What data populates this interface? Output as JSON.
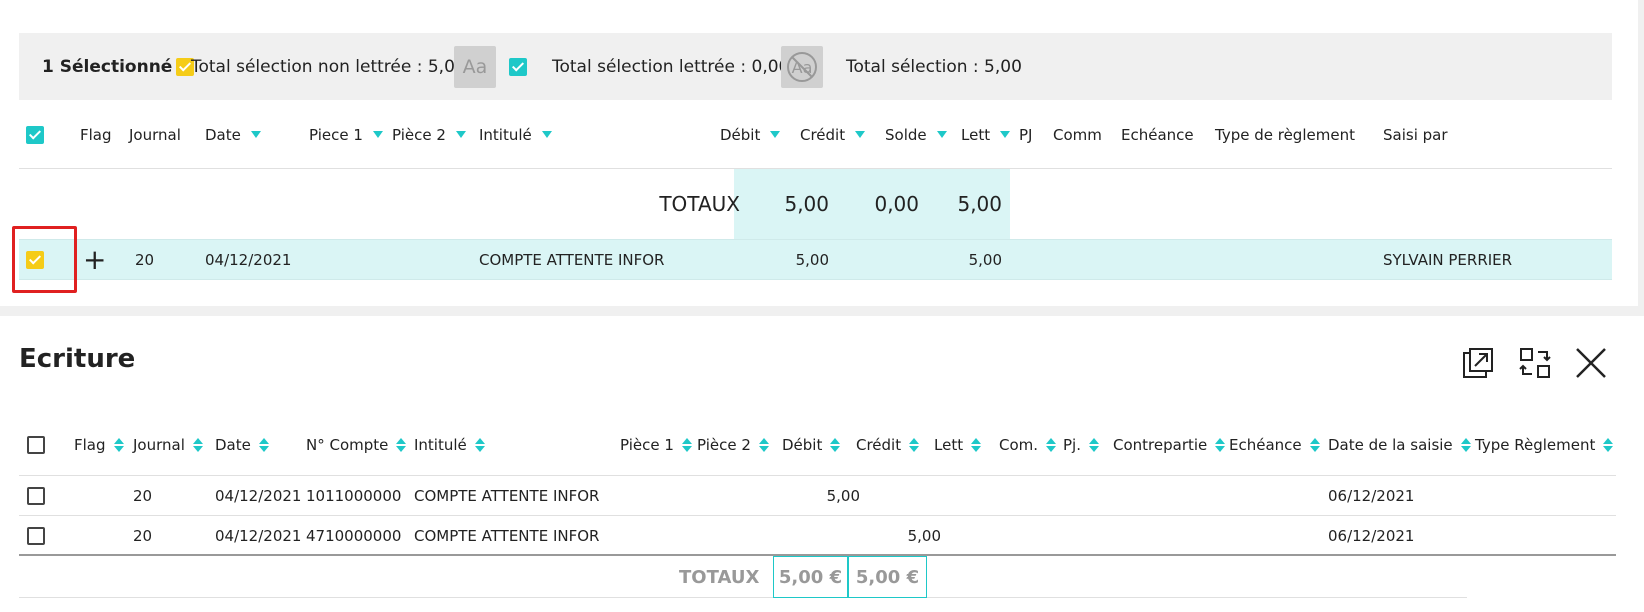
{
  "selection_bar": {
    "selected_label": "1 Sélectionné",
    "total_non_lettree": "Total sélection non lettrée : 5,00",
    "aa_label": "Aa",
    "total_lettree": "Total sélection lettrée : 0,00",
    "total_selection": "Total sélection : 5,00"
  },
  "top_table": {
    "columns": [
      "Flag",
      "Journal",
      "Date",
      "Piece 1",
      "Pièce 2",
      "Intitulé",
      "Débit",
      "Crédit",
      "Solde",
      "Lett",
      "PJ",
      "Comm",
      "Echéance",
      "Type de règlement",
      "Saisi par"
    ],
    "totals": {
      "label": "TOTAUX",
      "debit": "5,00",
      "credit": "0,00",
      "solde": "5,00"
    },
    "row": {
      "add": "+",
      "journal": "20",
      "date": "04/12/2021",
      "intitule": "COMPTE ATTENTE INFOR",
      "debit": "5,00",
      "solde": "5,00",
      "saisi_par": "SYLVAIN PERRIER"
    }
  },
  "ecriture": {
    "title": "Ecriture",
    "columns": [
      "Flag",
      "Journal",
      "Date",
      "N° Compte",
      "Intitulé",
      "Pièce 1",
      "Pièce 2",
      "Débit",
      "Crédit",
      "Lett",
      "Com.",
      "Pj.",
      "Contrepartie",
      "Echéance",
      "Date de la saisie",
      "Type Règlement"
    ],
    "rows": [
      {
        "journal": "20",
        "date": "04/12/2021",
        "compte": "1011000000",
        "intitule": "COMPTE ATTENTE INFOR",
        "debit": "5,00",
        "credit": "",
        "date_saisie": "06/12/2021"
      },
      {
        "journal": "20",
        "date": "04/12/2021",
        "compte": "4710000000",
        "intitule": "COMPTE ATTENTE INFOR",
        "debit": "",
        "credit": "5,00",
        "date_saisie": "06/12/2021"
      }
    ],
    "totals": {
      "label": "TOTAUX",
      "debit": "5,00 €",
      "credit": "5,00 €"
    }
  },
  "colors": {
    "accent": "#1ec8c8",
    "highlight": "#daf5f5",
    "selected": "#f5cc18",
    "alert": "#e02020"
  }
}
